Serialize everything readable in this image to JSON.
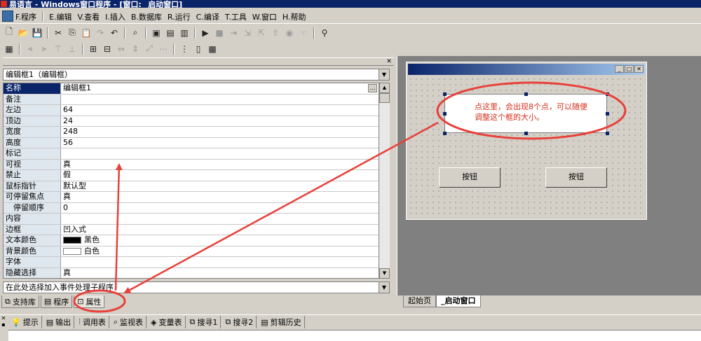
{
  "window": {
    "title": "易语言 - Windows窗口程序 - [窗口: _启动窗口]"
  },
  "menu": [
    "F.程序",
    "E.编辑",
    "V.查看",
    "I.插入",
    "B.数据库",
    "R.运行",
    "C.编译",
    "T.工具",
    "W.窗口",
    "H.帮助"
  ],
  "property_panel": {
    "object_selector": "编辑框1（编辑框）",
    "rows": [
      {
        "key": "名称",
        "value": "编辑框1"
      },
      {
        "key": "备注",
        "value": ""
      },
      {
        "key": "左边",
        "value": "64"
      },
      {
        "key": "顶边",
        "value": "24"
      },
      {
        "key": "宽度",
        "value": "248"
      },
      {
        "key": "高度",
        "value": "56"
      },
      {
        "key": "标记",
        "value": ""
      },
      {
        "key": "可视",
        "value": "真"
      },
      {
        "key": "禁止",
        "value": "假"
      },
      {
        "key": "鼠标指针",
        "value": "默认型"
      },
      {
        "key": "可停留焦点",
        "value": "真"
      },
      {
        "key": "停留顺序",
        "value": "0"
      },
      {
        "key": "内容",
        "value": ""
      },
      {
        "key": "边框",
        "value": "凹入式"
      },
      {
        "key": "文本颜色",
        "value": "黑色"
      },
      {
        "key": "背景颜色",
        "value": "白色"
      },
      {
        "key": "字体",
        "value": ""
      },
      {
        "key": "隐藏选择",
        "value": "真"
      }
    ],
    "colors": {
      "text": "#000000",
      "background": "#ffffff",
      "selected": "#0a246a"
    },
    "event_selector": "在此处选择加入事件处理子程序",
    "tabs": [
      "支持库",
      "程序",
      "属性"
    ]
  },
  "form_designer": {
    "editbox_text": "点这里，会出现8个点，可以随便调整这个框的大小。",
    "buttons": [
      "按钮",
      "按钮"
    ],
    "tabs": [
      "起始页",
      "_启动窗口"
    ]
  },
  "output_tabs": [
    "提示",
    "输出",
    "调用表",
    "监视表",
    "变量表",
    "搜寻1",
    "搜寻2",
    "剪辑历史"
  ],
  "annotation": {
    "color": "#e8403a"
  }
}
